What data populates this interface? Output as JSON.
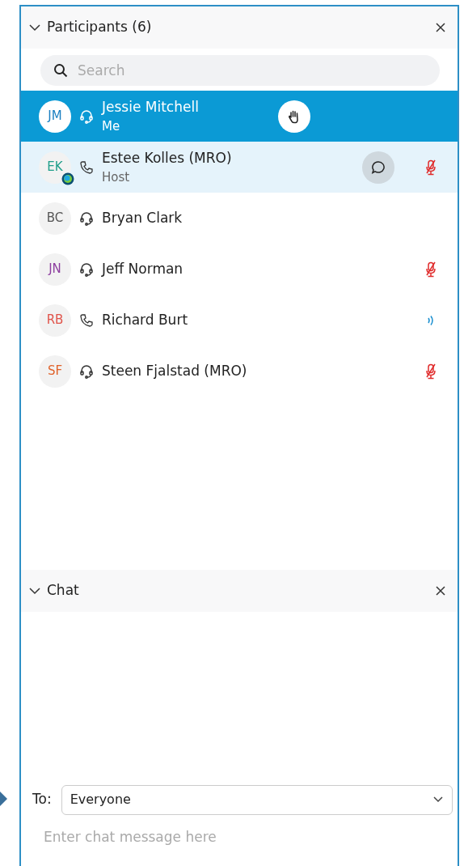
{
  "participants_panel": {
    "title": "Participants (6)",
    "expanded": true,
    "search": {
      "placeholder": "Search"
    },
    "participants": [
      {
        "initials": "JM",
        "color": "#1a7fc1",
        "on_phone": false,
        "name": "Jessie Mitchell",
        "role": "Me",
        "selected": true,
        "highlighted": false,
        "hand_raised": true
      },
      {
        "initials": "EK",
        "color": "#1f9e8a",
        "on_phone": true,
        "name": "Estee Kolles (MRO)",
        "role": "Host",
        "selected": false,
        "highlighted": true,
        "chat_button": true,
        "presence_badge": true,
        "muted": true
      },
      {
        "initials": "BC",
        "color": "#555555",
        "on_phone": false,
        "name": "Bryan Clark",
        "selected": false,
        "highlighted": false
      },
      {
        "initials": "JN",
        "color": "#8e3fa0",
        "on_phone": false,
        "name": "Jeff Norman",
        "selected": false,
        "highlighted": false,
        "muted": true
      },
      {
        "initials": "RB",
        "color": "#e0534a",
        "on_phone": true,
        "name": "Richard Burt",
        "selected": false,
        "highlighted": false,
        "speaking": true
      },
      {
        "initials": "SF",
        "color": "#e0622a",
        "on_phone": false,
        "name": "Steen Fjalstad (MRO)",
        "selected": false,
        "highlighted": false,
        "muted": true
      }
    ]
  },
  "chat_panel": {
    "title": "Chat",
    "expanded": true,
    "to_label": "To:",
    "recipient": "Everyone",
    "message": {
      "placeholder": "Enter chat message here"
    }
  }
}
